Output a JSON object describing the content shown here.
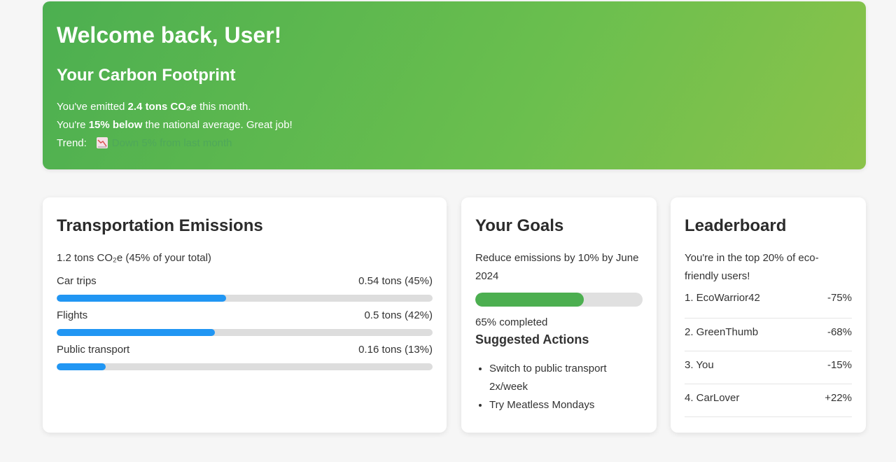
{
  "hero": {
    "welcome": "Welcome back, User!",
    "subtitle": "Your Carbon Footprint",
    "line1_pre": "You've emitted ",
    "line1_bold": "2.4 tons CO₂e",
    "line1_post": " this month.",
    "line2_pre": "You're ",
    "line2_bold": "15% below",
    "line2_post": " the national average. Great job!",
    "trend_label": "Trend:",
    "trend_icon": "chart-decreasing-icon",
    "trend_text": "Down 5% from last month"
  },
  "transport": {
    "title": "Transportation Emissions",
    "total": "1.2 tons CO₂e (45% of your total)",
    "rows": [
      {
        "label": "Car trips",
        "value": "0.54 tons (45%)",
        "percent": 45
      },
      {
        "label": "Flights",
        "value": "0.5 tons (42%)",
        "percent": 42
      },
      {
        "label": "Public transport",
        "value": "0.16 tons (13%)",
        "percent": 13
      }
    ],
    "bar_color": "#2196f3"
  },
  "goals": {
    "title": "Your Goals",
    "goal": "Reduce emissions by 10% by June 2024",
    "progress_percent": 65,
    "completed": "65% completed",
    "actions_title": "Suggested Actions",
    "actions": [
      "Switch to public transport 2x/week",
      "Try Meatless Mondays"
    ]
  },
  "leaderboard": {
    "title": "Leaderboard",
    "intro": "You're in the top 20% of eco-friendly users!",
    "rows": [
      {
        "name": "1. EcoWarrior42",
        "change": "-75%"
      },
      {
        "name": "2. GreenThumb",
        "change": "-68%"
      },
      {
        "name": "3. You",
        "change": "-15%"
      },
      {
        "name": "4. CarLover",
        "change": "+22%"
      }
    ]
  },
  "colors": {
    "accent_green": "#4caf50",
    "bar_blue": "#2196f3"
  }
}
